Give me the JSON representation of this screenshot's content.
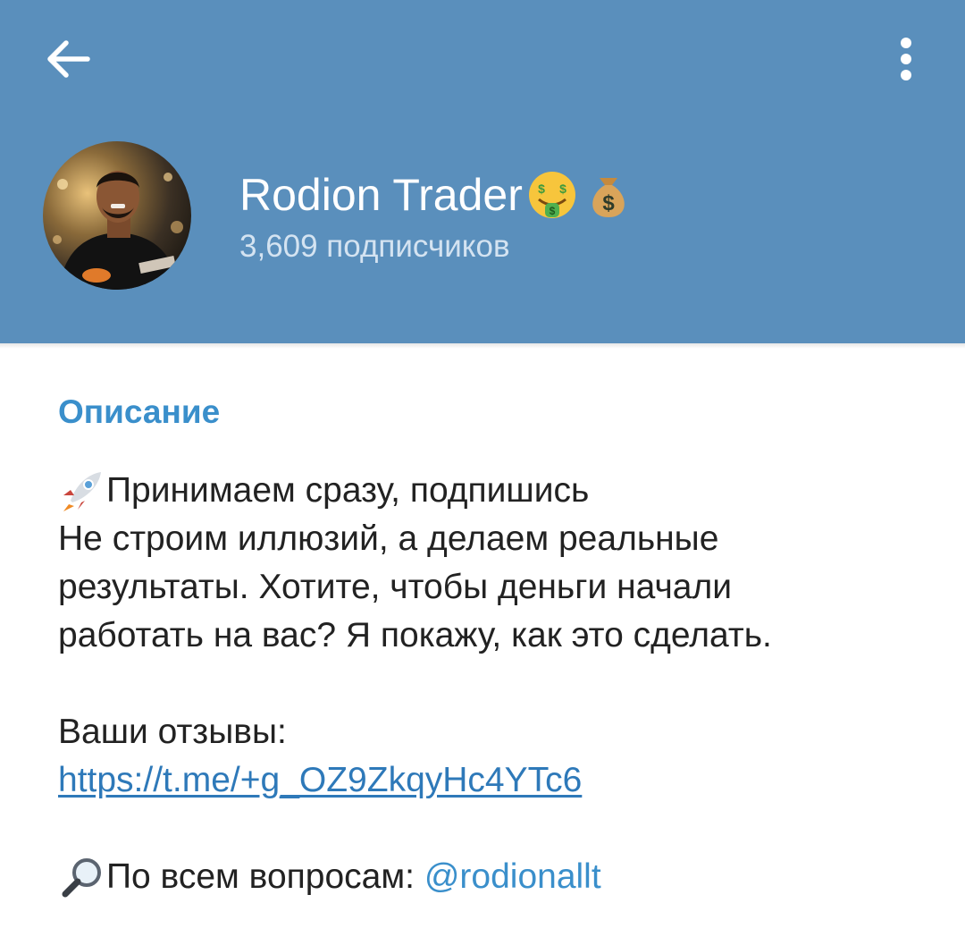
{
  "header": {
    "channel_name": "Rodion Trader",
    "name_emojis": [
      "money-mouth-face",
      "money-bag"
    ],
    "subscribers": "3,609 подписчиков",
    "background_color": "#5a8fbc"
  },
  "description": {
    "section_title": "Описание",
    "line1": "Принимаем сразу, подпишись",
    "line2": "Не строим иллюзий, а делаем реальные",
    "line3": "результаты. Хотите, чтобы деньги начали",
    "line4": "работать на вас? Я покажу, как это сделать.",
    "reviews_label": "Ваши отзывы:",
    "reviews_link": "https://t.me/+g_OZ9ZkqyHc4YTc6",
    "contact_label": "По всем вопросам: ",
    "contact_mention": "@rodionallt"
  },
  "icons": {
    "back": "arrow-left-icon",
    "more": "more-vertical-icon",
    "rocket": "rocket-icon",
    "magnifier": "magnifying-glass-icon"
  },
  "colors": {
    "accent": "#3a8fcb",
    "link": "#2e79b9",
    "text": "#222222"
  }
}
